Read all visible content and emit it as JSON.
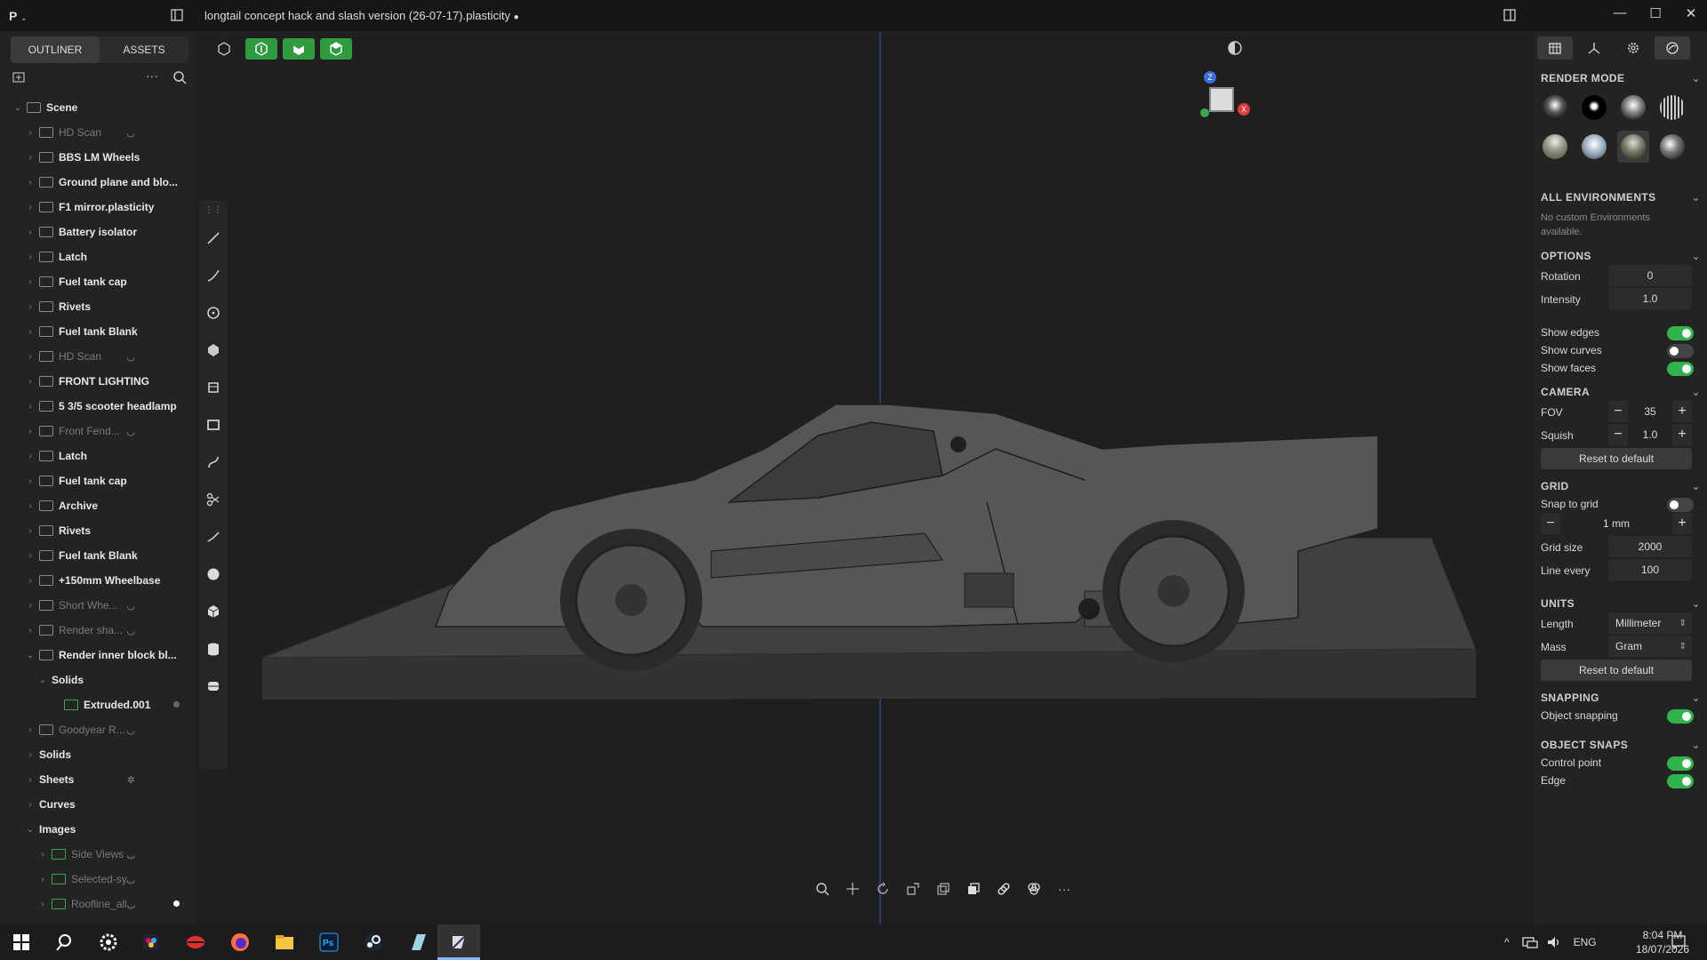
{
  "app": {
    "logo_label": "P",
    "title": "longtail concept hack and slash version (26-07-17).plasticity",
    "modified_marker": "●"
  },
  "sidebar": {
    "tabs": [
      {
        "label": "OUTLINER",
        "active": true
      },
      {
        "label": "ASSETS",
        "active": false
      }
    ],
    "tree": [
      {
        "label": "Scene",
        "depth": 0,
        "dim": false,
        "expanded": true,
        "type": "folder",
        "eye": false,
        "dot": ""
      },
      {
        "label": "HD Scan",
        "depth": 1,
        "dim": true,
        "expanded": false,
        "type": "folder",
        "eye": true,
        "dot": ""
      },
      {
        "label": "BBS LM Wheels",
        "depth": 1,
        "dim": false,
        "expanded": false,
        "type": "folder",
        "eye": false,
        "dot": ""
      },
      {
        "label": "Ground plane and blo...",
        "depth": 1,
        "dim": false,
        "expanded": false,
        "type": "folder",
        "eye": false,
        "dot": ""
      },
      {
        "label": "F1 mirror.plasticity",
        "depth": 1,
        "dim": false,
        "expanded": false,
        "type": "folder",
        "eye": false,
        "dot": ""
      },
      {
        "label": "Battery isolator",
        "depth": 1,
        "dim": false,
        "expanded": false,
        "type": "folder",
        "eye": false,
        "dot": ""
      },
      {
        "label": "Latch",
        "depth": 1,
        "dim": false,
        "expanded": false,
        "type": "folder",
        "eye": false,
        "dot": ""
      },
      {
        "label": "Fuel tank cap",
        "depth": 1,
        "dim": false,
        "expanded": false,
        "type": "folder",
        "eye": false,
        "dot": ""
      },
      {
        "label": "Rivets",
        "depth": 1,
        "dim": false,
        "expanded": false,
        "type": "folder",
        "eye": false,
        "dot": ""
      },
      {
        "label": "Fuel tank Blank",
        "depth": 1,
        "dim": false,
        "expanded": false,
        "type": "folder",
        "eye": false,
        "dot": ""
      },
      {
        "label": "HD Scan",
        "depth": 1,
        "dim": true,
        "expanded": false,
        "type": "folder",
        "eye": true,
        "dot": ""
      },
      {
        "label": "FRONT LIGHTING",
        "depth": 1,
        "dim": false,
        "expanded": false,
        "type": "folder",
        "eye": false,
        "dot": ""
      },
      {
        "label": "5 3/5 scooter headlamp",
        "depth": 1,
        "dim": false,
        "expanded": false,
        "type": "folder",
        "eye": false,
        "dot": ""
      },
      {
        "label": "Front Fend...",
        "depth": 1,
        "dim": true,
        "expanded": false,
        "type": "folder",
        "eye": true,
        "dot": ""
      },
      {
        "label": "Latch",
        "depth": 1,
        "dim": false,
        "expanded": false,
        "type": "folder",
        "eye": false,
        "dot": ""
      },
      {
        "label": "Fuel tank cap",
        "depth": 1,
        "dim": false,
        "expanded": false,
        "type": "folder",
        "eye": false,
        "dot": ""
      },
      {
        "label": "Archive",
        "depth": 1,
        "dim": false,
        "expanded": false,
        "type": "folder",
        "eye": false,
        "dot": ""
      },
      {
        "label": "Rivets",
        "depth": 1,
        "dim": false,
        "expanded": false,
        "type": "folder",
        "eye": false,
        "dot": ""
      },
      {
        "label": "Fuel tank Blank",
        "depth": 1,
        "dim": false,
        "expanded": false,
        "type": "folder",
        "eye": false,
        "dot": ""
      },
      {
        "label": "+150mm Wheelbase",
        "depth": 1,
        "dim": false,
        "expanded": false,
        "type": "folder",
        "eye": false,
        "dot": ""
      },
      {
        "label": "Short Whe...",
        "depth": 1,
        "dim": true,
        "expanded": false,
        "type": "folder",
        "eye": true,
        "dot": ""
      },
      {
        "label": "Render sha...",
        "depth": 1,
        "dim": true,
        "expanded": false,
        "type": "folder",
        "eye": true,
        "dot": ""
      },
      {
        "label": "Render inner block bl...",
        "depth": 1,
        "dim": false,
        "expanded": true,
        "type": "folder",
        "eye": false,
        "dot": ""
      },
      {
        "label": "Solids",
        "depth": 2,
        "dim": false,
        "expanded": true,
        "type": "none",
        "eye": false,
        "dot": ""
      },
      {
        "label": "Extruded.001",
        "depth": 3,
        "dim": false,
        "expanded": false,
        "type": "solid",
        "eye": false,
        "dot": "grey"
      },
      {
        "label": "Goodyear R...",
        "depth": 1,
        "dim": true,
        "expanded": false,
        "type": "folder",
        "eye": true,
        "dot": ""
      },
      {
        "label": "Solids",
        "depth": 1,
        "dim": false,
        "expanded": false,
        "type": "none",
        "eye": false,
        "dot": ""
      },
      {
        "label": "Sheets",
        "depth": 1,
        "dim": false,
        "expanded": false,
        "type": "none",
        "eye": false,
        "dot": "",
        "hidden_icon": true
      },
      {
        "label": "Curves",
        "depth": 1,
        "dim": false,
        "expanded": false,
        "type": "none",
        "eye": false,
        "dot": ""
      },
      {
        "label": "Images",
        "depth": 1,
        "dim": false,
        "expanded": true,
        "type": "none",
        "eye": false,
        "dot": ""
      },
      {
        "label": "Side Views ...",
        "depth": 2,
        "dim": true,
        "expanded": false,
        "type": "image",
        "eye": true,
        "dot": ""
      },
      {
        "label": "Selected-sy...",
        "depth": 2,
        "dim": true,
        "expanded": false,
        "type": "image",
        "eye": true,
        "dot": ""
      },
      {
        "label": "Roofline_all...",
        "depth": 2,
        "dim": true,
        "expanded": false,
        "type": "image",
        "eye": true,
        "dot": "white"
      }
    ]
  },
  "viewport": {
    "gizmo_labels": {
      "z": "Z",
      "x": "X"
    }
  },
  "right_panel": {
    "render_mode": {
      "title": "RENDER MODE"
    },
    "environments": {
      "title": "ALL ENVIRONMENTS",
      "note": "No custom Environments available."
    },
    "options": {
      "title": "OPTIONS",
      "rotation_label": "Rotation",
      "rotation": "0",
      "intensity_label": "Intensity",
      "intensity": "1.0",
      "show_edges_label": "Show edges",
      "show_edges": true,
      "show_curves_label": "Show curves",
      "show_curves": false,
      "show_faces_label": "Show faces",
      "show_faces": true
    },
    "camera": {
      "title": "CAMERA",
      "fov_label": "FOV",
      "fov": "35",
      "squish_label": "Squish",
      "squish": "1.0",
      "reset_label": "Reset to default"
    },
    "grid": {
      "title": "GRID",
      "snap_label": "Snap to grid",
      "snap": false,
      "step": "1 mm",
      "size_label": "Grid size",
      "size": "2000",
      "every_label": "Line every",
      "every": "100"
    },
    "units": {
      "title": "UNITS",
      "length_label": "Length",
      "length": "Millimeter",
      "mass_label": "Mass",
      "mass": "Gram",
      "reset_label": "Reset to default"
    },
    "snapping": {
      "title": "SNAPPING",
      "object_label": "Object snapping",
      "object": true
    },
    "object_snaps": {
      "title": "OBJECT SNAPS",
      "control_label": "Control point",
      "control": true,
      "edge_label": "Edge",
      "edge": true
    }
  },
  "taskbar": {
    "lang": "ENG",
    "time": "8:04 PM",
    "date": "18/07/2026"
  },
  "colors": {
    "accent_green": "#2fb34a",
    "panel_bg": "#232323",
    "viewport_bg": "#1f1f20"
  }
}
